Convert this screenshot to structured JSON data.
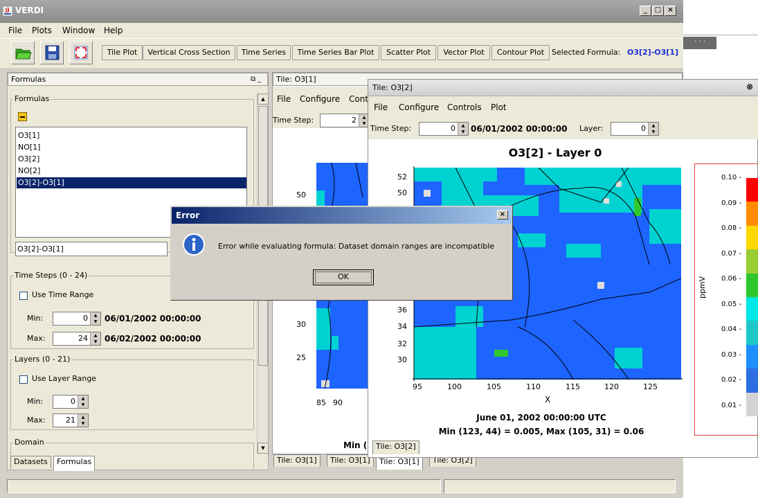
{
  "window": {
    "title": "VERDI"
  },
  "menubar": [
    "File",
    "Plots",
    "Window",
    "Help"
  ],
  "toolbar": {
    "plot_buttons": [
      "Tile Plot",
      "Vertical Cross Section",
      "Time Series",
      "Time Series Bar Plot",
      "Scatter Plot",
      "Vector Plot",
      "Contour Plot"
    ],
    "selected_formula_label": "Selected Formula:",
    "selected_formula_value": "O3[2]-O3[1]",
    "right_dots": "· · ·"
  },
  "formulas_panel": {
    "header": "Formulas",
    "group_label": "Formulas",
    "list": [
      "O3[1]",
      "NO[1]",
      "O3[2]",
      "NO[2]",
      "O3[2]-O3[1]"
    ],
    "selected_index": 4,
    "formula_input": "O3[2]-O3[1]",
    "time_steps": {
      "label": "Time Steps (0 - 24)",
      "use_range": "Use Time Range",
      "min_label": "Min:",
      "min_value": "0",
      "min_date": "06/01/2002 00:00:00",
      "max_label": "Max:",
      "max_value": "24",
      "max_date": "06/02/2002 00:00:00"
    },
    "layers": {
      "label": "Layers (0 - 21)",
      "use_range": "Use Layer Range",
      "min_label": "Min:",
      "min_value": "0",
      "max_label": "Max:",
      "max_value": "21"
    },
    "domain_label": "Domain",
    "tabs": [
      "Datasets",
      "Formulas"
    ]
  },
  "tile1": {
    "title": "Tile: O3[1]",
    "menu": [
      "File",
      "Configure",
      "Cont"
    ],
    "time_step_label": "Time Step:",
    "time_step_value": "2",
    "y_ticks": [
      "50",
      "30",
      "25"
    ],
    "x_ticks": [
      "85",
      "90"
    ],
    "footer_partial": "Min (",
    "bottom_tabs": [
      "Tile: O3[1]",
      "Tile: O3[1]",
      "Tile: O3[1]",
      "Tile: O3[2]"
    ]
  },
  "tile2": {
    "title": "Tile: O3[2]",
    "menu": [
      "File",
      "Configure",
      "Controls",
      "Plot"
    ],
    "time_step_label": "Time Step:",
    "time_step_value": "0",
    "date": "06/01/2002 00:00:00",
    "layer_label": "Layer:",
    "layer_value": "0",
    "plot_title": "O3[2] - Layer 0",
    "y_ticks": [
      "52",
      "50",
      "36",
      "34",
      "32",
      "30"
    ],
    "x_ticks": [
      "95",
      "100",
      "105",
      "110",
      "115",
      "120",
      "125"
    ],
    "x_label": "X",
    "footer_date": "June 01, 2002 00:00:00 UTC",
    "footer_minmax": "Min (123, 44) = 0.005, Max (105, 31) = 0.06",
    "legend_unit": "ppmV",
    "legend_ticks": [
      "0.10",
      "0.09",
      "0.08",
      "0.07",
      "0.06",
      "0.05",
      "0.04",
      "0.03",
      "0.02",
      "0.01"
    ],
    "legend_colors": [
      "#ff0000",
      "#ff8c00",
      "#ffd700",
      "#9acd32",
      "#2ec82e",
      "#00e5e5",
      "#1ec8c8",
      "#1e90ff",
      "#2d6fe0",
      "#d3d3d3"
    ],
    "bottom_tab": "Tile: O3[2]"
  },
  "error_dialog": {
    "title": "Error",
    "message": "Error while evaluating formula: Dataset domain ranges are incompatible",
    "ok": "OK"
  },
  "colors": {
    "selection": "#0a246a",
    "formula_value": "#1c2ed8",
    "map_blue": "#1e64ff",
    "map_cyan": "#00d2d2"
  }
}
